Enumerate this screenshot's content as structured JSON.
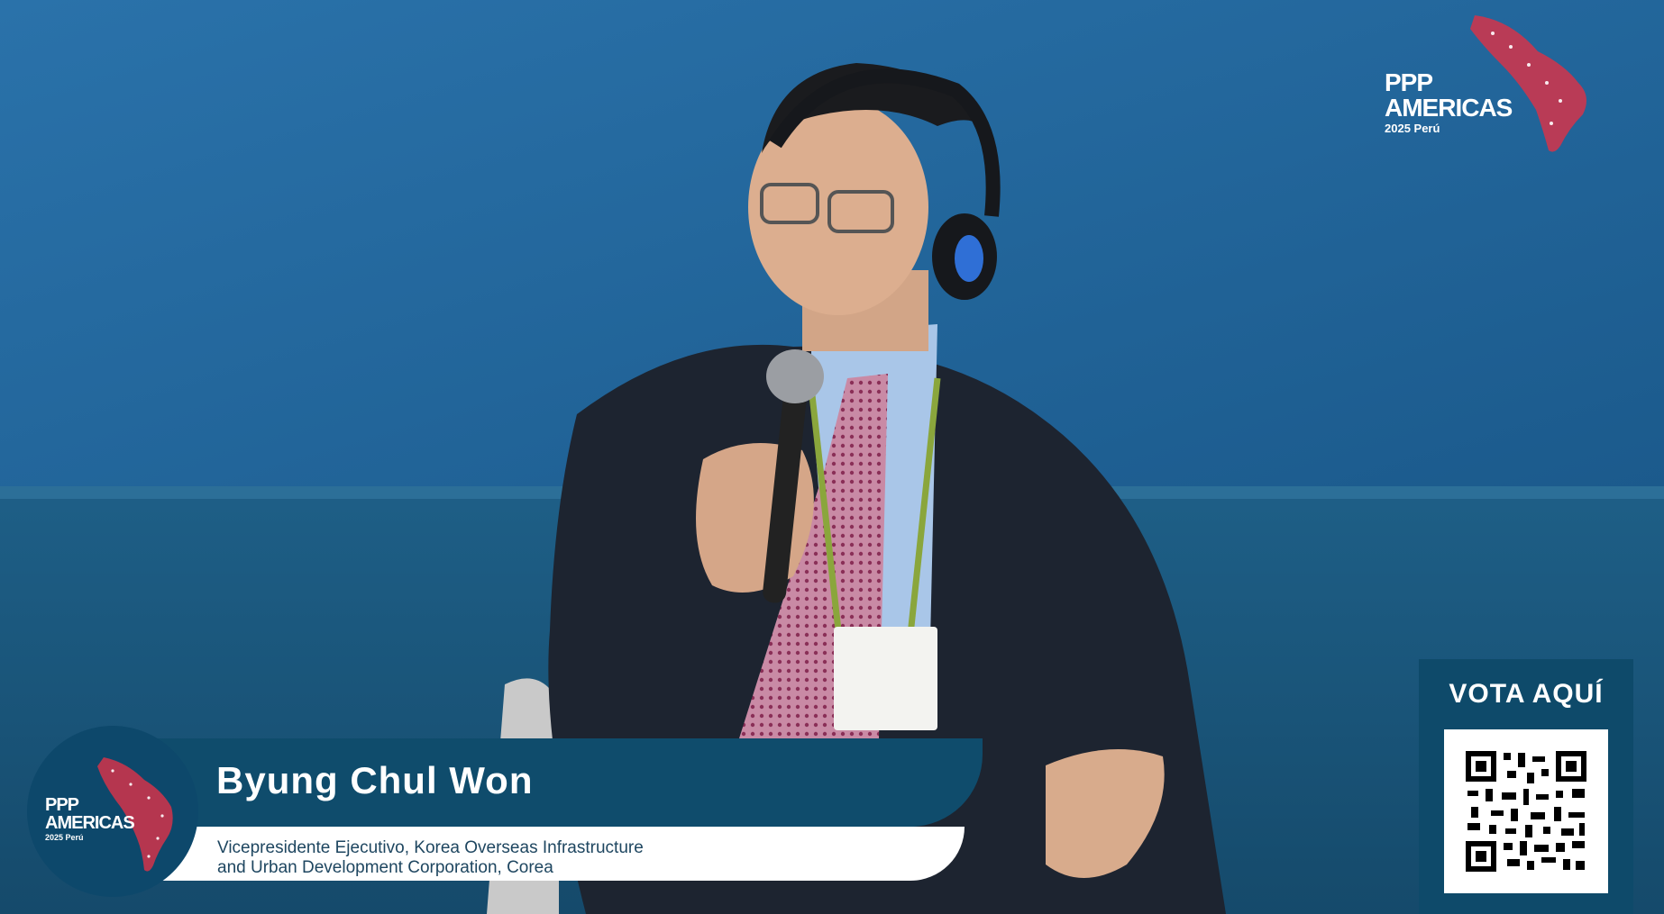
{
  "brand": {
    "line1": "PPP",
    "line2": "AMERICAS",
    "line3": "2025 Perú"
  },
  "vote": {
    "label": "VOTA AQUÍ"
  },
  "speaker": {
    "name": "Byung Chul Won",
    "title_line1": "Vicepresidente Ejecutivo, Korea Overseas Infrastructure",
    "title_line2": "and Urban Development Corporation, Corea"
  },
  "colors": {
    "backdrop": "#1c5f92",
    "panel": "#0f4c6c",
    "accent_red": "#d3344a"
  }
}
